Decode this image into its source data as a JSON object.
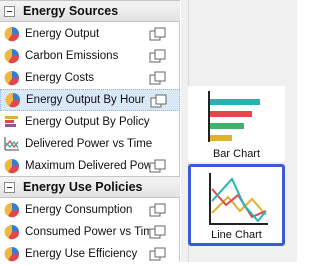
{
  "sections": [
    {
      "title": "Energy Sources",
      "items": [
        {
          "label": "Energy Output",
          "icon": "pie-chart-icon"
        },
        {
          "label": "Carbon Emissions",
          "icon": "pie-chart-icon"
        },
        {
          "label": "Energy Costs",
          "icon": "pie-chart-icon"
        },
        {
          "label": "Energy Output By Hour",
          "icon": "pie-chart-icon",
          "selected": true
        },
        {
          "label": "Energy Output By Policy",
          "icon": "bar-chart-icon"
        },
        {
          "label": "Delivered Power vs Time",
          "icon": "line-chart-icon"
        },
        {
          "label": "Maximum Delivered Power",
          "icon": "pie-chart-icon"
        }
      ]
    },
    {
      "title": "Energy Use Policies",
      "items": [
        {
          "label": "Energy Consumption",
          "icon": "pie-chart-icon"
        },
        {
          "label": "Consumed Power vs Time",
          "icon": "pie-chart-icon"
        },
        {
          "label": "Energy Use Efficiency",
          "icon": "pie-chart-icon"
        }
      ]
    }
  ],
  "chart_types": [
    {
      "label": "Bar Chart",
      "icon": "bar-chart-icon",
      "selected": false
    },
    {
      "label": "Line Chart",
      "icon": "line-chart-icon",
      "selected": true
    }
  ],
  "colors": {
    "selection_border": "#3b5bd6",
    "bar_teal": "#26b3b3",
    "bar_red": "#e0484a",
    "bar_green": "#40b36a",
    "bar_gold": "#e0b030"
  }
}
